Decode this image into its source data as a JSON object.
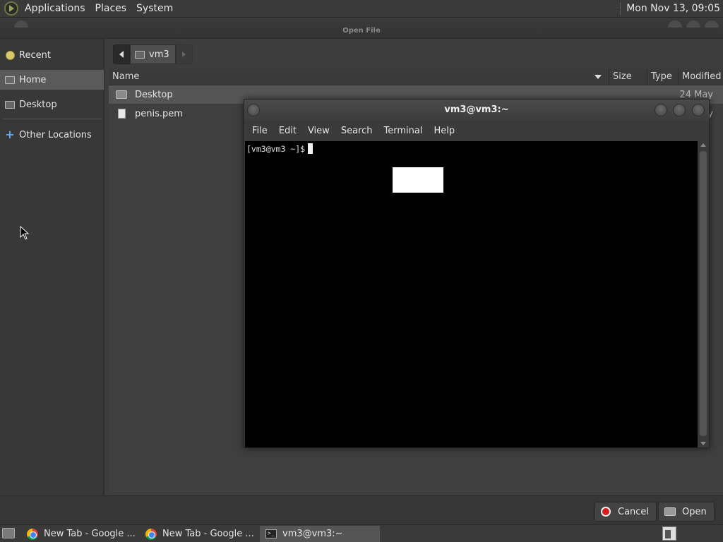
{
  "top_panel": {
    "menus": [
      "Applications",
      "Places",
      "System"
    ],
    "clock": "Mon Nov 13, 09:05"
  },
  "dialog": {
    "title": "Open File",
    "sidebar": {
      "items": [
        {
          "label": "Recent",
          "icon": "recent-icon"
        },
        {
          "label": "Home",
          "icon": "home-folder-icon",
          "active": true
        },
        {
          "label": "Desktop",
          "icon": "desktop-folder-icon"
        },
        {
          "label": "Other Locations",
          "icon": "plus-icon"
        }
      ]
    },
    "pathbar": {
      "current": "vm3"
    },
    "columns": {
      "name": "Name",
      "size": "Size",
      "type": "Type",
      "modified": "Modified"
    },
    "files": [
      {
        "name": "Desktop",
        "icon": "folder-icon",
        "modified": "24 May",
        "selected": true
      },
      {
        "name": "penis.pem",
        "icon": "document-icon",
        "modified": "y",
        "selected": false
      }
    ],
    "buttons": {
      "cancel": "Cancel",
      "open": "Open"
    }
  },
  "terminal": {
    "title": "vm3@vm3:~",
    "menus": [
      "File",
      "Edit",
      "View",
      "Search",
      "Terminal",
      "Help"
    ],
    "prompt": "[vm3@vm3 ~]$"
  },
  "taskbar": {
    "tasks": [
      {
        "label": "New Tab - Google ...",
        "icon": "chrome-icon"
      },
      {
        "label": "New Tab - Google ...",
        "icon": "chrome-icon"
      },
      {
        "label": "vm3@vm3:~",
        "icon": "terminal-icon",
        "active": true
      }
    ]
  }
}
